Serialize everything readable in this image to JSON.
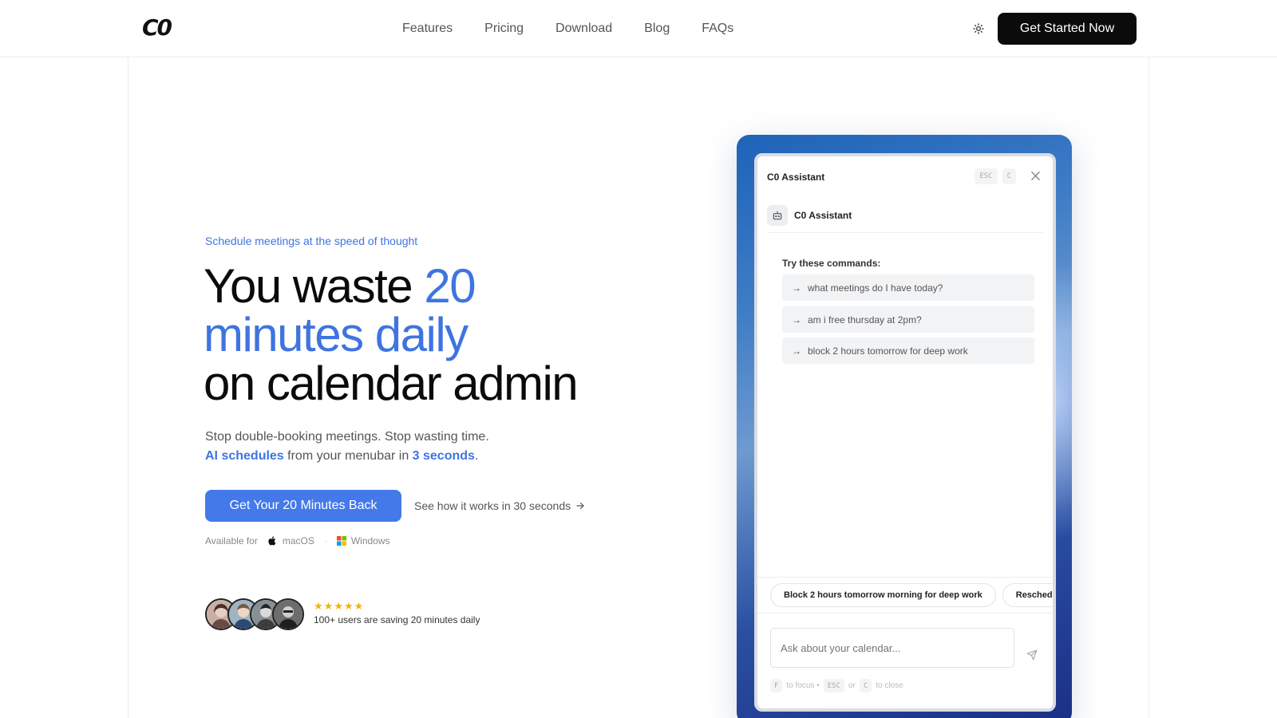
{
  "nav": {
    "logo": "C0",
    "links": [
      "Features",
      "Pricing",
      "Download",
      "Blog",
      "FAQs"
    ],
    "cta": "Get Started Now",
    "theme_icon": "sun-icon"
  },
  "hero": {
    "tagline": "Schedule meetings at the speed of thought",
    "headline": {
      "part1": "You waste ",
      "accent1": "20",
      "accent2": "minutes daily",
      "part2": "on calendar admin"
    },
    "sub": {
      "line1": "Stop double-booking meetings. Stop wasting time.",
      "hl1": "AI schedules",
      "mid": " from your menubar in ",
      "hl2": "3 seconds",
      "end": "."
    },
    "primary_button": "Get Your 20 Minutes Back",
    "video_link": "See how it works in 30 seconds",
    "available_for": "Available for",
    "platforms": [
      "macOS",
      "Windows"
    ],
    "rating_stars": 5,
    "social_proof": "100+ users are saving 20 minutes daily"
  },
  "assistant": {
    "window_title": "C0 Assistant",
    "keys": [
      "ESC",
      "C"
    ],
    "assistant_name": "C0 Assistant",
    "try_label": "Try these commands:",
    "commands": [
      "what meetings do I have today?",
      "am i free thursday at 2pm?",
      "block 2 hours tomorrow for deep work"
    ],
    "chips": [
      "Block 2 hours tomorrow morning for deep work",
      "Reschedule"
    ],
    "input_placeholder": "Ask about your calendar...",
    "hints": {
      "key_focus": "F",
      "focus_text": "to focus •",
      "key_esc": "ESC",
      "or_text": "or",
      "key_c": "C",
      "close_text": "to close"
    }
  },
  "colors": {
    "accent": "#3f74e0",
    "button_primary": "#4479ea",
    "dark": "#0b0b0b",
    "star": "#f5b400"
  }
}
